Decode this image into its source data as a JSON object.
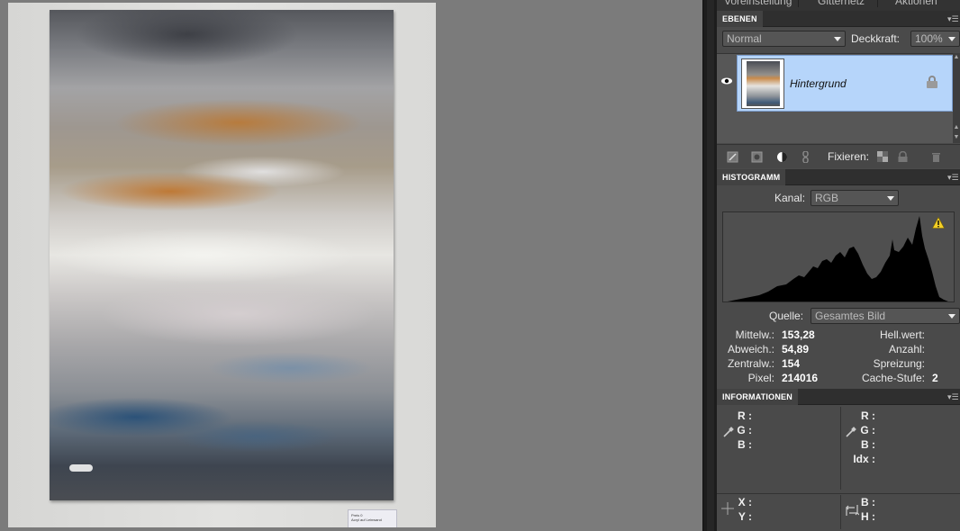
{
  "top_tabs": [
    "Voreinstellung",
    "Gitternetz",
    "Aktionen"
  ],
  "photo_label": [
    "Preis 0",
    "Acryl auf Leinwand"
  ],
  "ebenen": {
    "title": "EBENEN",
    "blend_mode": "Normal",
    "opacity_label": "Deckkraft:",
    "opacity_value": "100%",
    "layer_name": "Hintergrund",
    "fix_label": "Fixieren:"
  },
  "histogram": {
    "title": "HISTOGRAMM",
    "channel_label": "Kanal:",
    "channel_value": "RGB",
    "source_label": "Quelle:",
    "source_value": "Gesamtes Bild",
    "stats_left": [
      {
        "label": "Mittelw.:",
        "value": "153,28"
      },
      {
        "label": "Abweich.:",
        "value": "54,89"
      },
      {
        "label": "Zentralw.:",
        "value": "154"
      },
      {
        "label": "Pixel:",
        "value": "214016"
      }
    ],
    "stats_right": [
      {
        "label": "Hell.wert:",
        "value": ""
      },
      {
        "label": "Anzahl:",
        "value": ""
      },
      {
        "label": "Spreizung:",
        "value": ""
      },
      {
        "label": "Cache-Stufe:",
        "value": "2"
      }
    ]
  },
  "info": {
    "title": "INFORMATIONEN",
    "left": [
      "R :",
      "G :",
      "B :"
    ],
    "right": [
      "R :",
      "G :",
      "B :",
      "Idx :"
    ],
    "xy": [
      "X :",
      "Y :"
    ],
    "bh": [
      "B :",
      "H :"
    ]
  },
  "colors": {
    "panel_bg": "#4a4a4a",
    "selection": "#b6d5fa",
    "warning": "#f3cf27"
  }
}
